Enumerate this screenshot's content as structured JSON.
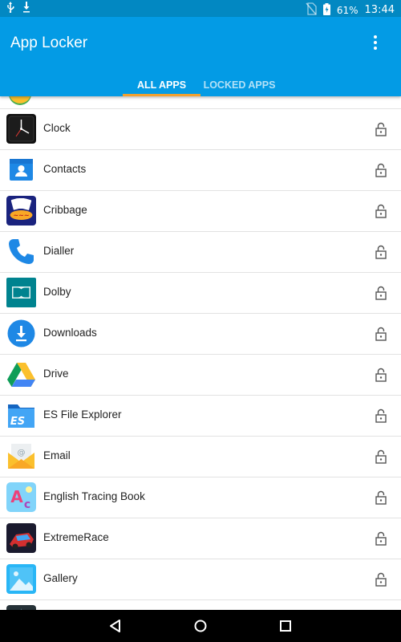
{
  "status_bar": {
    "battery": "61%",
    "time": "13:44",
    "icons": [
      "usb-icon",
      "download-icon",
      "no-sim-icon",
      "battery-charging-icon"
    ]
  },
  "app_bar": {
    "title": "App Locker",
    "menu_icon": "more-vert-icon"
  },
  "tabs": [
    {
      "label": "ALL APPS",
      "active": true
    },
    {
      "label": "LOCKED APPS",
      "active": false
    }
  ],
  "apps": [
    {
      "name": "Clock",
      "icon": "clock-icon",
      "locked": false
    },
    {
      "name": "Contacts",
      "icon": "contacts-icon",
      "locked": false
    },
    {
      "name": "Cribbage",
      "icon": "cribbage-icon",
      "locked": false
    },
    {
      "name": "Dialler",
      "icon": "phone-icon",
      "locked": false
    },
    {
      "name": "Dolby",
      "icon": "dolby-icon",
      "locked": false
    },
    {
      "name": "Downloads",
      "icon": "downloads-icon",
      "locked": false
    },
    {
      "name": "Drive",
      "icon": "drive-icon",
      "locked": false
    },
    {
      "name": "ES File Explorer",
      "icon": "es-file-explorer-icon",
      "locked": false
    },
    {
      "name": "Email",
      "icon": "email-icon",
      "locked": false
    },
    {
      "name": "English Tracing Book",
      "icon": "english-tracing-book-icon",
      "locked": false
    },
    {
      "name": "ExtremeRace",
      "icon": "extremerace-icon",
      "locked": false
    },
    {
      "name": "Gallery",
      "icon": "gallery-icon",
      "locked": false
    }
  ],
  "colors": {
    "status_bar": "#0288c2",
    "app_bar": "#039be5",
    "tab_indicator": "#f0a030"
  },
  "nav_bar": [
    "back-icon",
    "home-icon",
    "recents-icon"
  ]
}
